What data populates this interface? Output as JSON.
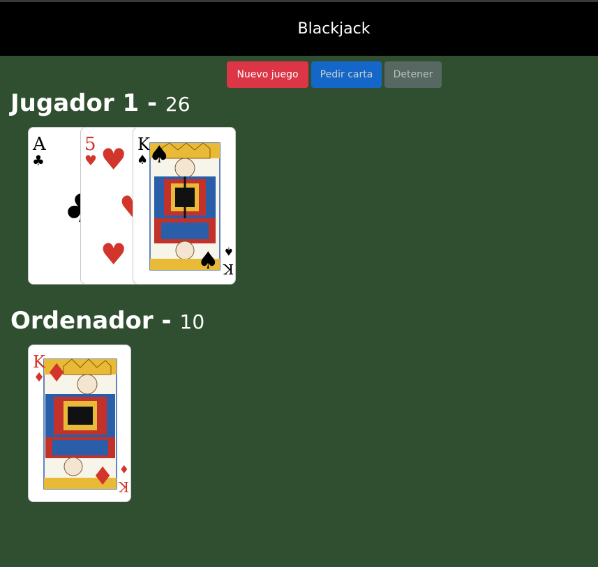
{
  "header": {
    "title": "Blackjack"
  },
  "buttons": {
    "new_game": "Nuevo juego",
    "hit": "Pedir carta",
    "stand": "Detener"
  },
  "players": [
    {
      "name": "Jugador 1",
      "separator": "-",
      "score": "26",
      "cards": [
        {
          "rank": "A",
          "suit": "clubs",
          "suit_symbol": "♣",
          "color": "#000000"
        },
        {
          "rank": "5",
          "suit": "hearts",
          "suit_symbol": "♥",
          "color": "#d1352b"
        },
        {
          "rank": "K",
          "suit": "spades",
          "suit_symbol": "♠",
          "color": "#000000"
        }
      ]
    },
    {
      "name": "Ordenador",
      "separator": "-",
      "score": "10",
      "cards": [
        {
          "rank": "K",
          "suit": "diamonds",
          "suit_symbol": "♦",
          "color": "#d1352b"
        }
      ]
    }
  ],
  "colors": {
    "table": "#304f30",
    "header": "#000000",
    "new_game_button": "#dc3545",
    "hit_button": "#0d6efd",
    "stand_button": "#6c757d"
  }
}
